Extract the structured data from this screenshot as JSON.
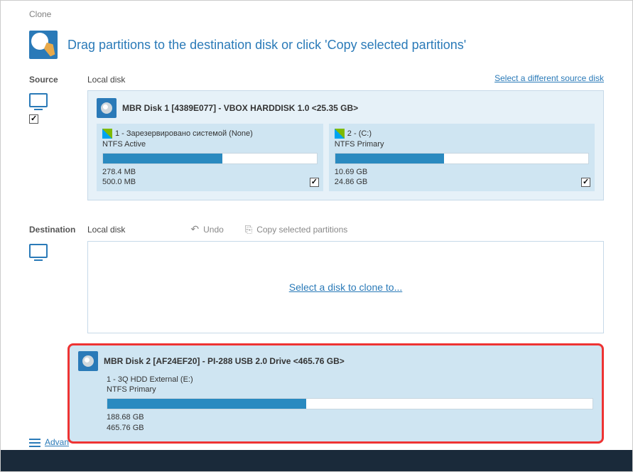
{
  "window_title": "Clone",
  "header_text": "Drag partitions to the destination disk or click 'Copy selected partitions'",
  "source": {
    "label": "Source",
    "location": "Local disk",
    "link": "Select a different source disk",
    "disk_title": "MBR Disk 1 [4389E077] - VBOX HARDDISK 1.0  <25.35 GB>",
    "partitions": [
      {
        "label": "1 - Зарезервировано системой (None)",
        "fs": "NTFS Active",
        "used": "278.4 MB",
        "total": "500.0 MB",
        "fill_pct": 56,
        "checked": true,
        "width": "46%"
      },
      {
        "label": "2 -  (C:)",
        "fs": "NTFS Primary",
        "used": "10.69 GB",
        "total": "24.86 GB",
        "fill_pct": 43,
        "checked": true,
        "width": "54%"
      }
    ]
  },
  "destination": {
    "label": "Destination",
    "location": "Local disk",
    "undo": "Undo",
    "copy": "Copy selected partitions",
    "placeholder": "Select a disk to clone to..."
  },
  "selected_disk": {
    "title": "MBR Disk 2 [AF24EF20] - PI-288   USB 2.0 Drive   <465.76 GB>",
    "partition": {
      "label": "1 - 3Q HDD External (E:)",
      "fs": "NTFS Primary",
      "used": "188.68 GB",
      "total": "465.76 GB",
      "fill_pct": 41
    }
  },
  "advanced_link": "Advan"
}
